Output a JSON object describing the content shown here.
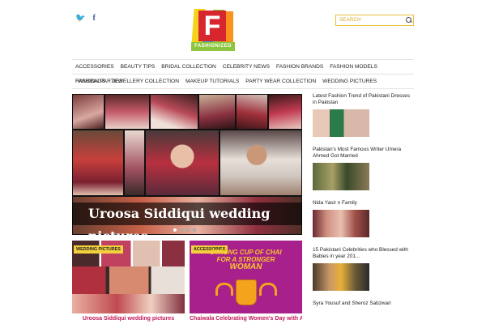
{
  "social": {
    "twitter": "🐦",
    "facebook": "f"
  },
  "logo": {
    "letter": "F",
    "ribbon": "FASHIONIZED"
  },
  "search": {
    "placeholder": "SEARCH"
  },
  "nav": {
    "row1": [
      "ACCESSORIES",
      "BEAUTY TIPS",
      "BRIDAL COLLECTION",
      "CELEBRITY NEWS",
      "FASHION BRANDS",
      "FASHION MODELS",
      "FASHION PARTIES"
    ],
    "row2": [
      "HANDBAGS",
      "JEWELLERY COLLECTION",
      "MAKEUP TUTORIALS",
      "PARTY WEAR COLLECTION",
      "WEDDING PICTURES"
    ]
  },
  "hero": {
    "caption": "Uroosa Siddiqui wedding pictures"
  },
  "cards": [
    {
      "tag": "WEDDING PICTURES",
      "title": "Uroosa Siddiqui wedding pictures"
    },
    {
      "tag": "ACCESSORIES",
      "title": "Chaiwala Celebrating Women's Day with A",
      "poster": [
        "STRONG CUP OF CHAI",
        "FOR A STRONGER",
        "WOMAN"
      ]
    }
  ],
  "sidebar": [
    {
      "title": "Latest Fashion Trend of Pakistani Dresses in Pakistan"
    },
    {
      "title": "Pakistan's Most Famous Writer Umera Ahmed Got Married"
    },
    {
      "title": "Nida Yasir n Family"
    },
    {
      "title": "15 Pakistani Celebrities who Blessed with Babies in year 201..."
    },
    {
      "title": "Syra Yousuf and Sheroz Sabzwari"
    }
  ]
}
